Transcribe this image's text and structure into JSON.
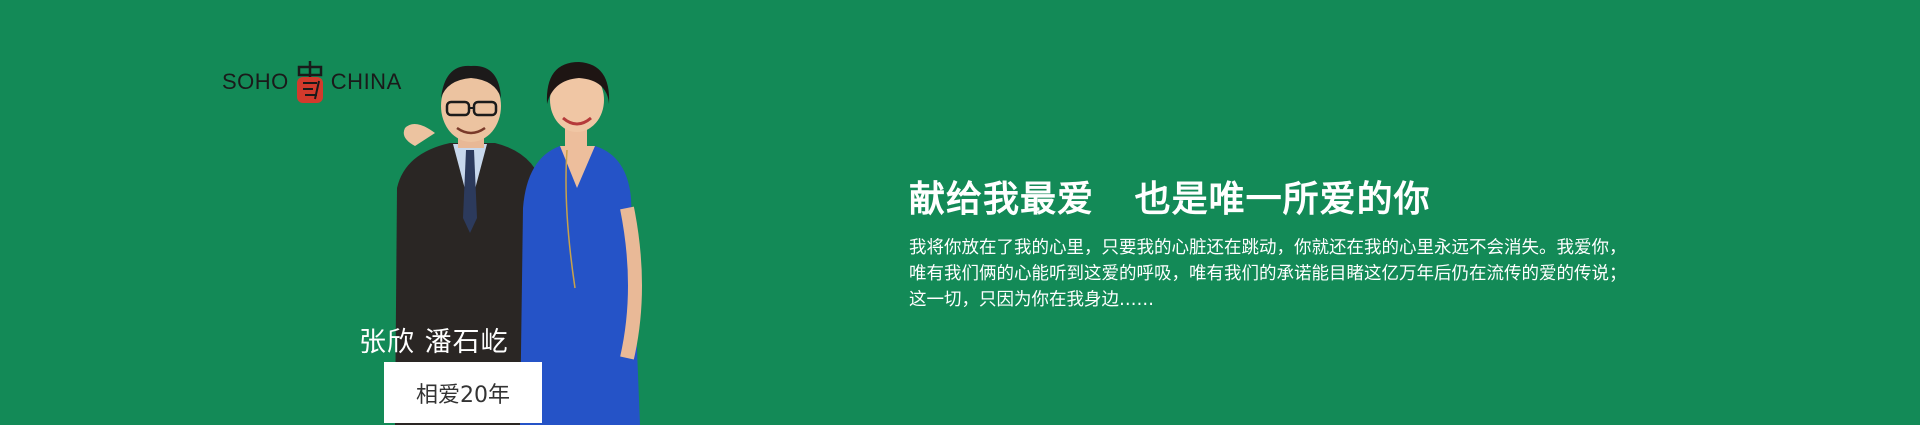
{
  "brand": {
    "logo_left": "SOHO",
    "logo_right": "CHINA",
    "seal_icon": "soho-china-seal-icon"
  },
  "colors": {
    "background": "#138a57",
    "text": "#ffffff",
    "badge_bg": "#ffffff",
    "badge_text": "#333333",
    "seal_red": "#d23a2c"
  },
  "photo": {
    "names": "张欣 潘石屹",
    "years_label": "相爱20年"
  },
  "message": {
    "headline": "献给我最爱   也是唯一所爱的你",
    "lines": [
      "我将你放在了我的心里，只要我的心脏还在跳动，你就还在我的心里永远不会消失。我爱你，",
      "唯有我们俩的心能听到这爱的呼吸，唯有我们的承诺能目睹这亿万年后仍在流传的爱的传说；",
      "这一切，只因为你在我身边……"
    ]
  }
}
